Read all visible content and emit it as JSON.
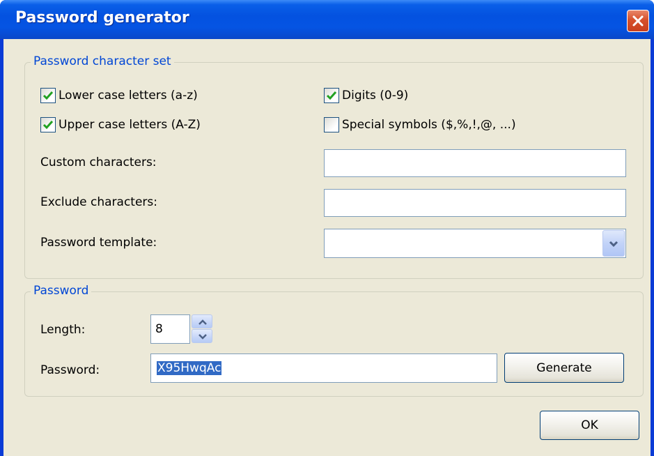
{
  "window": {
    "title": "Password generator"
  },
  "charset_group": {
    "title": "Password character set",
    "lower": {
      "label": "Lower case letters (a-z)",
      "checked": true
    },
    "upper": {
      "label": "Upper case letters (A-Z)",
      "checked": true
    },
    "digits": {
      "label": "Digits (0-9)",
      "checked": true
    },
    "special": {
      "label": "Special symbols ($,%,!,@, ...)",
      "checked": false
    },
    "custom_label": "Custom characters:",
    "custom_value": "",
    "exclude_label": "Exclude characters:",
    "exclude_value": "",
    "template_label": "Password template:",
    "template_value": ""
  },
  "password_group": {
    "title": "Password",
    "length_label": "Length:",
    "length_value": "8",
    "password_label": "Password:",
    "password_value": "X95HwqAc",
    "generate_label": "Generate"
  },
  "footer": {
    "ok_label": "OK"
  },
  "colors": {
    "title_bar": "#0554e3",
    "client_bg": "#ece9d8",
    "group_title": "#0046d5",
    "check_mark": "#21a121",
    "selection": "#316ac5"
  }
}
